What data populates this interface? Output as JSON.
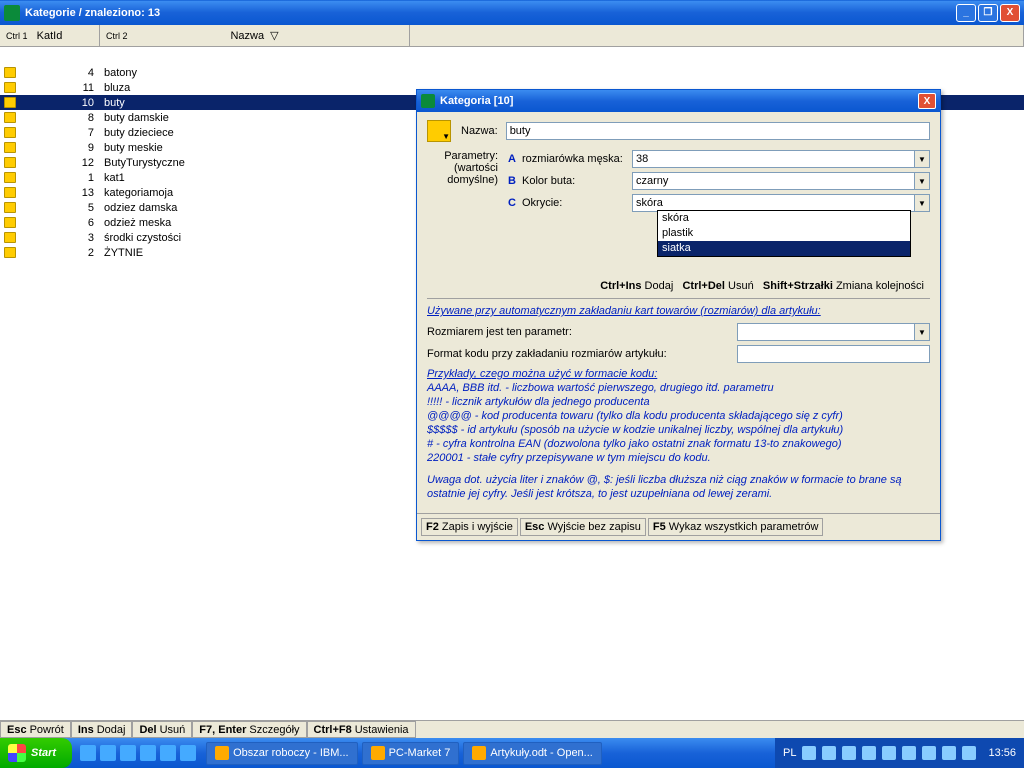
{
  "window": {
    "title": "Kategorie / znaleziono: 13"
  },
  "columns": {
    "c1_hint": "Ctrl 1",
    "c1": "KatId",
    "c2_hint": "Ctrl 2",
    "c2": "Nazwa",
    "sort": "▽"
  },
  "rows": [
    {
      "id": "4",
      "name": "batony"
    },
    {
      "id": "11",
      "name": "bluza"
    },
    {
      "id": "10",
      "name": "buty",
      "selected": true
    },
    {
      "id": "8",
      "name": "buty damskie"
    },
    {
      "id": "7",
      "name": "buty dzieciece"
    },
    {
      "id": "9",
      "name": "buty meskie"
    },
    {
      "id": "12",
      "name": "ButyTurystyczne"
    },
    {
      "id": "1",
      "name": "kat1"
    },
    {
      "id": "13",
      "name": "kategoriamoja"
    },
    {
      "id": "5",
      "name": "odziez damska"
    },
    {
      "id": "6",
      "name": "odzież meska"
    },
    {
      "id": "3",
      "name": "środki czystości"
    },
    {
      "id": "2",
      "name": "ŻYTNIE"
    }
  ],
  "dialog": {
    "title": "Kategoria [10]",
    "name_label": "Nazwa:",
    "name_value": "buty",
    "params_label1": "Parametry:",
    "params_label2": "(wartości",
    "params_label3": "domyślne)",
    "params": [
      {
        "letter": "A",
        "name": "rozmiarówka męska:",
        "value": "38"
      },
      {
        "letter": "B",
        "name": "Kolor buta:",
        "value": "czarny"
      },
      {
        "letter": "C",
        "name": "Okrycie:",
        "value": "skóra"
      }
    ],
    "dropdown": [
      "skóra",
      "plastik",
      "siatka"
    ],
    "actions": {
      "a1k": "Ctrl+Ins",
      "a1": "Dodaj",
      "a2k": "Ctrl+Del",
      "a2": "Usuń",
      "a3k": "Shift+Strzałki",
      "a3": "Zmiana kolejności"
    },
    "link": "Używane przy automatycznym zakładaniu kart towarów (rozmiarów) dla artykułu:",
    "rozm_label": "Rozmiarem jest ten parametr:",
    "format_label": "Format kodu przy zakładaniu rozmiarów artykułu:",
    "help_title": "Przykłady, czego można użyć w formacie kodu:",
    "help1": "AAAA, BBB itd. - liczbowa wartość pierwszego, drugiego itd. parametru",
    "help2": "!!!!! - licznik artykułów dla jednego producenta",
    "help3": "@@@@ - kod producenta towaru (tylko dla kodu producenta składającego się z cyfr)",
    "help4": "$$$$$ - id artykułu (sposób na użycie w kodzie unikalnej liczby, wspólnej dla artykułu)",
    "help5": "# - cyfra kontrolna EAN (dozwolona tylko jako ostatni znak formatu 13-to znakowego)",
    "help6": "220001 - stałe cyfry przepisywane w tym miejscu do kodu.",
    "help7": "Uwaga dot. użycia liter i znaków @, $: jeśli liczba dłuższa niż ciąg znaków w formacie to brane są ostatnie jej cyfry. Jeśli jest krótsza, to jest uzupełniana od lewej zerami.",
    "status": {
      "s1k": "F2",
      "s1": "Zapis i wyjście",
      "s2k": "Esc",
      "s2": "Wyjście bez zapisu",
      "s3k": "F5",
      "s3": "Wykaz wszystkich parametrów"
    }
  },
  "mainstatus": {
    "s1k": "Esc",
    "s1": "Powrót",
    "s2k": "Ins",
    "s2": "Dodaj",
    "s3k": "Del",
    "s3": "Usuń",
    "s4k": "F7, Enter",
    "s4": "Szczegóły",
    "s5k": "Ctrl+F8",
    "s5": "Ustawienia"
  },
  "taskbar": {
    "start": "Start",
    "tasks": [
      "Obszar roboczy - IBM...",
      "PC-Market 7",
      "Artykuły.odt - Open..."
    ],
    "lang": "PL",
    "clock": "13:56"
  }
}
